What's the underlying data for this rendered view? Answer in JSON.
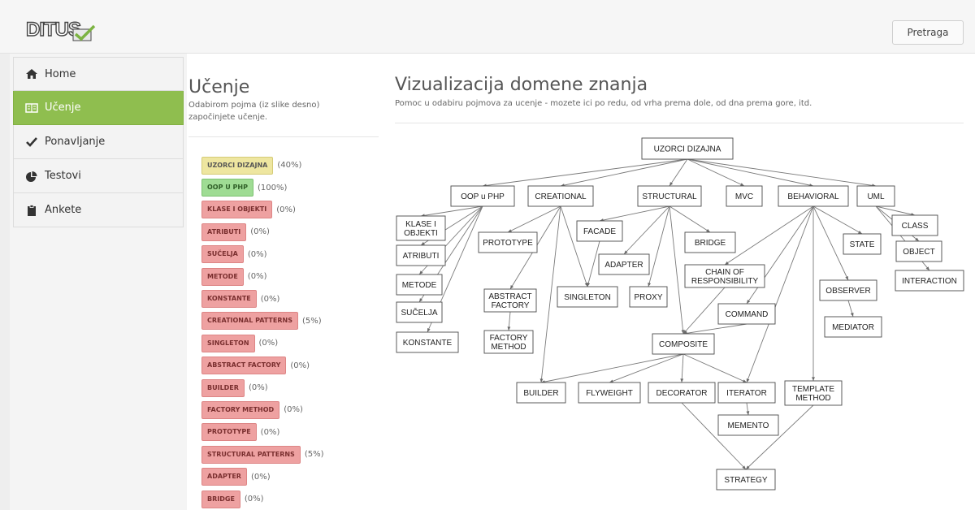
{
  "header": {
    "logo_text": "DITUS",
    "search_label": "Pretraga"
  },
  "sidebar": {
    "items": [
      {
        "label": "Home",
        "icon": "home-icon",
        "active": false
      },
      {
        "label": "Učenje",
        "icon": "book-icon",
        "active": true
      },
      {
        "label": "Ponavljanje",
        "icon": "check-icon",
        "active": false
      },
      {
        "label": "Testovi",
        "icon": "pie-chart-icon",
        "active": false
      },
      {
        "label": "Ankete",
        "icon": "clipboard-icon",
        "active": false
      }
    ]
  },
  "learning": {
    "title": "Učenje",
    "subtitle": "Odabirom pojma (iz slike desno) započinjete učenje.",
    "concepts": [
      {
        "label": "UZORCI DIZAJNA",
        "pct": "(40%)",
        "color": "yellow"
      },
      {
        "label": "OOP U PHP",
        "pct": "(100%)",
        "color": "green"
      },
      {
        "label": "KLASE I OBJEKTI",
        "pct": "(0%)",
        "color": "red"
      },
      {
        "label": "ATRIBUTI",
        "pct": "(0%)",
        "color": "red"
      },
      {
        "label": "SUČELJA",
        "pct": "(0%)",
        "color": "red"
      },
      {
        "label": "METODE",
        "pct": "(0%)",
        "color": "red"
      },
      {
        "label": "KONSTANTE",
        "pct": "(0%)",
        "color": "red"
      },
      {
        "label": "CREATIONAL PATTERNS",
        "pct": "(5%)",
        "color": "red"
      },
      {
        "label": "SINGLETON",
        "pct": "(0%)",
        "color": "red"
      },
      {
        "label": "ABSTRACT FACTORY",
        "pct": "(0%)",
        "color": "red"
      },
      {
        "label": "BUILDER",
        "pct": "(0%)",
        "color": "red"
      },
      {
        "label": "FACTORY METHOD",
        "pct": "(0%)",
        "color": "red"
      },
      {
        "label": "PROTOTYPE",
        "pct": "(0%)",
        "color": "red"
      },
      {
        "label": "STRUCTURAL PATTERNS",
        "pct": "(5%)",
        "color": "red"
      },
      {
        "label": "ADAPTER",
        "pct": "(0%)",
        "color": "red"
      },
      {
        "label": "BRIDGE",
        "pct": "(0%)",
        "color": "red"
      }
    ]
  },
  "visualization": {
    "title": "Vizualizacija domene znanja",
    "subtitle": "Pomoc u odabiru pojmova za ucenje - mozete ici po redu, od vrha prema dole, od dna prema gore, itd.",
    "nodes": [
      {
        "id": "uzorci",
        "lines": [
          "UZORCI DIZAJNA"
        ]
      },
      {
        "id": "oop",
        "lines": [
          "OOP u PHP"
        ]
      },
      {
        "id": "creational",
        "lines": [
          "CREATIONAL"
        ]
      },
      {
        "id": "structural",
        "lines": [
          "STRUCTURAL"
        ]
      },
      {
        "id": "mvc",
        "lines": [
          "MVC"
        ]
      },
      {
        "id": "behavioral",
        "lines": [
          "BEHAVIORAL"
        ]
      },
      {
        "id": "uml",
        "lines": [
          "UML"
        ]
      },
      {
        "id": "klase",
        "lines": [
          "KLASE I",
          "OBJEKTI"
        ]
      },
      {
        "id": "atributi",
        "lines": [
          "ATRIBUTI"
        ]
      },
      {
        "id": "metode",
        "lines": [
          "METODE"
        ]
      },
      {
        "id": "sucelja",
        "lines": [
          "SUČELJA"
        ]
      },
      {
        "id": "konstante",
        "lines": [
          "KONSTANTE"
        ]
      },
      {
        "id": "prototype",
        "lines": [
          "PROTOTYPE"
        ]
      },
      {
        "id": "abstract",
        "lines": [
          "ABSTRACT",
          "FACTORY"
        ]
      },
      {
        "id": "factory",
        "lines": [
          "FACTORY",
          "METHOD"
        ]
      },
      {
        "id": "facade",
        "lines": [
          "FACADE"
        ]
      },
      {
        "id": "adapter",
        "lines": [
          "ADAPTER"
        ]
      },
      {
        "id": "singleton",
        "lines": [
          "SINGLETON"
        ]
      },
      {
        "id": "proxy",
        "lines": [
          "PROXY"
        ]
      },
      {
        "id": "bridge",
        "lines": [
          "BRIDGE"
        ]
      },
      {
        "id": "chain",
        "lines": [
          "CHAIN OF",
          "RESPONSIBILITY"
        ]
      },
      {
        "id": "command",
        "lines": [
          "COMMAND"
        ]
      },
      {
        "id": "composite",
        "lines": [
          "COMPOSITE"
        ]
      },
      {
        "id": "state",
        "lines": [
          "STATE"
        ]
      },
      {
        "id": "observer",
        "lines": [
          "OBSERVER"
        ]
      },
      {
        "id": "mediator",
        "lines": [
          "MEDIATOR"
        ]
      },
      {
        "id": "class",
        "lines": [
          "CLASS"
        ]
      },
      {
        "id": "object",
        "lines": [
          "OBJECT"
        ]
      },
      {
        "id": "interaction",
        "lines": [
          "INTERACTION"
        ]
      },
      {
        "id": "builder",
        "lines": [
          "BUILDER"
        ]
      },
      {
        "id": "flyweight",
        "lines": [
          "FLYWEIGHT"
        ]
      },
      {
        "id": "decorator",
        "lines": [
          "DECORATOR"
        ]
      },
      {
        "id": "iterator",
        "lines": [
          "ITERATOR"
        ]
      },
      {
        "id": "template",
        "lines": [
          "TEMPLATE",
          "METHOD"
        ]
      },
      {
        "id": "memento",
        "lines": [
          "MEMENTO"
        ]
      },
      {
        "id": "strategy",
        "lines": [
          "STRATEGY"
        ]
      }
    ],
    "edges": [
      [
        "uzorci",
        "oop"
      ],
      [
        "uzorci",
        "creational"
      ],
      [
        "uzorci",
        "structural"
      ],
      [
        "uzorci",
        "mvc"
      ],
      [
        "uzorci",
        "behavioral"
      ],
      [
        "uzorci",
        "uml"
      ],
      [
        "oop",
        "klase"
      ],
      [
        "oop",
        "atributi"
      ],
      [
        "oop",
        "metode"
      ],
      [
        "oop",
        "sucelja"
      ],
      [
        "oop",
        "konstante"
      ],
      [
        "creational",
        "prototype"
      ],
      [
        "creational",
        "abstract"
      ],
      [
        "creational",
        "singleton"
      ],
      [
        "creational",
        "builder"
      ],
      [
        "abstract",
        "factory"
      ],
      [
        "facade",
        "singleton"
      ],
      [
        "structural",
        "facade"
      ],
      [
        "structural",
        "adapter"
      ],
      [
        "structural",
        "proxy"
      ],
      [
        "structural",
        "bridge"
      ],
      [
        "structural",
        "composite"
      ],
      [
        "behavioral",
        "chain"
      ],
      [
        "behavioral",
        "command"
      ],
      [
        "behavioral",
        "state"
      ],
      [
        "behavioral",
        "observer"
      ],
      [
        "behavioral",
        "iterator"
      ],
      [
        "behavioral",
        "template"
      ],
      [
        "chain",
        "composite"
      ],
      [
        "command",
        "composite"
      ],
      [
        "observer",
        "mediator"
      ],
      [
        "uml",
        "class"
      ],
      [
        "uml",
        "object"
      ],
      [
        "uml",
        "interaction"
      ],
      [
        "composite",
        "builder"
      ],
      [
        "composite",
        "flyweight"
      ],
      [
        "composite",
        "decorator"
      ],
      [
        "composite",
        "iterator"
      ],
      [
        "iterator",
        "memento"
      ],
      [
        "decorator",
        "strategy"
      ],
      [
        "template",
        "strategy"
      ]
    ]
  }
}
